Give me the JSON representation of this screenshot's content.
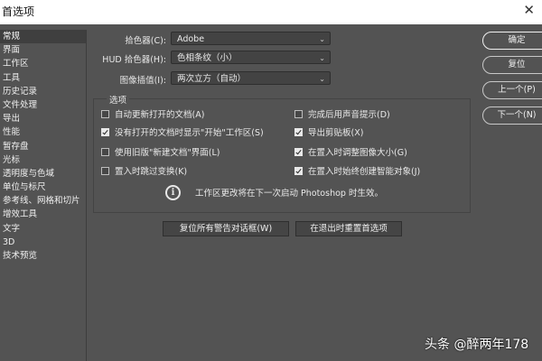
{
  "window": {
    "title": "首选项"
  },
  "sidebar": {
    "items": [
      {
        "label": "常规",
        "selected": true
      },
      {
        "label": "界面"
      },
      {
        "label": "工作区"
      },
      {
        "label": "工具"
      },
      {
        "label": "历史记录"
      },
      {
        "label": "文件处理"
      },
      {
        "label": "导出"
      },
      {
        "label": "性能"
      },
      {
        "label": "暂存盘"
      },
      {
        "label": "光标"
      },
      {
        "label": "透明度与色域"
      },
      {
        "label": "单位与标尺"
      },
      {
        "label": "参考线、网格和切片"
      },
      {
        "label": "增效工具"
      },
      {
        "label": "文字"
      },
      {
        "label": "3D"
      },
      {
        "label": "技术预览"
      }
    ]
  },
  "fields": {
    "color_picker": {
      "label": "拾色器(C):",
      "value": "Adobe"
    },
    "hud_color_picker": {
      "label": "HUD 拾色器(H):",
      "value": "色相条纹（小）"
    },
    "image_interpolation": {
      "label": "图像插值(I):",
      "value": "两次立方（自动）"
    }
  },
  "options": {
    "title": "选项",
    "checkboxes": [
      {
        "label": "自动更新打开的文档(A)",
        "checked": false
      },
      {
        "label": "完成后用声音提示(D)",
        "checked": false
      },
      {
        "label": "没有打开的文档时显示\"开始\"工作区(S)",
        "checked": true
      },
      {
        "label": "导出剪贴板(X)",
        "checked": true
      },
      {
        "label": "使用旧版\"新建文档\"界面(L)",
        "checked": false
      },
      {
        "label": "在置入时调整图像大小(G)",
        "checked": true
      },
      {
        "label": "置入时跳过变换(K)",
        "checked": false
      },
      {
        "label": "在置入时始终创建智能对象(J)",
        "checked": true
      }
    ],
    "info": "工作区更改将在下一次启动 Photoshop 时生效。"
  },
  "buttons": {
    "ok": "确定",
    "reset": "复位",
    "prev": "上一个(P)",
    "next": "下一个(N)",
    "reset_warnings": "复位所有警告对话框(W)",
    "reset_on_quit": "在退出时重置首选项"
  },
  "watermark": "头条 @醉两年178"
}
